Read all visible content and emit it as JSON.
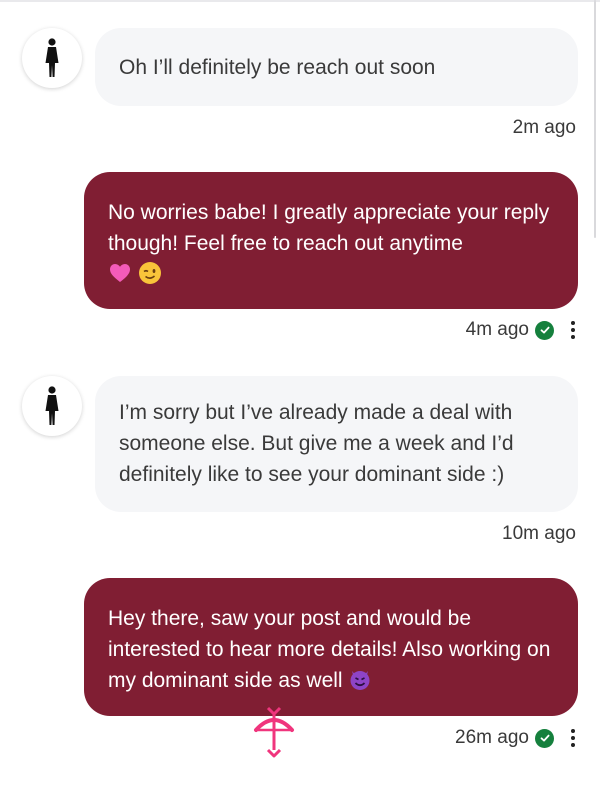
{
  "messages": [
    {
      "direction": "received",
      "text": "Oh I’ll definitely be reach out soon",
      "time": "2m ago"
    },
    {
      "direction": "sent",
      "text": "No worries babe! I greatly appreciate your reply though! Feel free to reach out anytime",
      "emojis": [
        "pink-heart",
        "winking-face"
      ],
      "time": "4m ago",
      "status": "read"
    },
    {
      "direction": "received",
      "text": "I’m sorry but I’ve already made a deal with someone else. But give me a week and I’d definitely like to see your dominant side :)",
      "time": "10m ago"
    },
    {
      "direction": "sent",
      "text": "Hey there, saw your post and would be interested to hear more details! Also working on my dominant side as well",
      "emojis": [
        "smiling-devil"
      ],
      "time": "26m ago",
      "status": "read"
    }
  ],
  "colors": {
    "sent_bubble": "#801e33",
    "received_bubble": "#f5f6f8",
    "read_check": "#15803d",
    "brand_pink": "#f0357d"
  },
  "icons": {
    "avatar": "woman-silhouette-icon",
    "status": "check-circle-icon",
    "menu": "kebab-menu-icon",
    "fab": "cupid-bow-icon"
  }
}
